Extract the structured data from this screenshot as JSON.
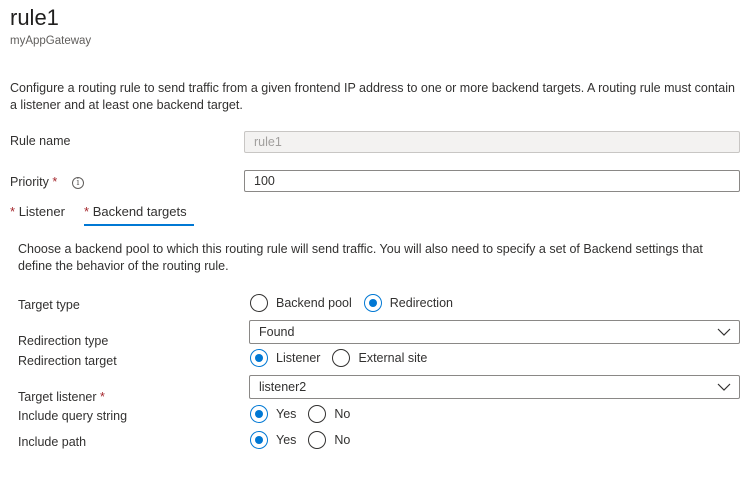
{
  "header": {
    "title": "rule1",
    "subtitle": "myAppGateway"
  },
  "description": "Configure a routing rule to send traffic from a given frontend IP address to one or more backend targets. A routing rule must contain a listener and at least one backend target.",
  "rule_name": {
    "label": "Rule name",
    "value": "rule1"
  },
  "priority": {
    "label": "Priority",
    "required_mark": "*",
    "info_glyph": "i",
    "value": "100"
  },
  "tabs": [
    {
      "required_mark": "*",
      "label": "Listener",
      "selected": false
    },
    {
      "required_mark": "*",
      "label": "Backend targets",
      "selected": true
    }
  ],
  "backend": {
    "description": "Choose a backend pool to which this routing rule will send traffic. You will also need to specify a set of Backend settings that define the behavior of the routing rule.",
    "target_type": {
      "label": "Target type",
      "options": [
        {
          "label": "Backend pool",
          "selected": false
        },
        {
          "label": "Redirection",
          "selected": true
        }
      ]
    },
    "redirection_type": {
      "label": "Redirection type",
      "value": "Found"
    },
    "redirection_target": {
      "label": "Redirection target",
      "options": [
        {
          "label": "Listener",
          "selected": true
        },
        {
          "label": "External site",
          "selected": false
        }
      ]
    },
    "target_listener": {
      "label": "Target listener",
      "required_mark": "*",
      "value": "listener2"
    },
    "include_query_string": {
      "label": "Include query string",
      "options": [
        {
          "label": "Yes",
          "selected": true
        },
        {
          "label": "No",
          "selected": false
        }
      ]
    },
    "include_path": {
      "label": "Include path",
      "options": [
        {
          "label": "Yes",
          "selected": true
        },
        {
          "label": "No",
          "selected": false
        }
      ]
    }
  },
  "colors": {
    "accent": "#0078d4",
    "required": "#a4262c"
  }
}
